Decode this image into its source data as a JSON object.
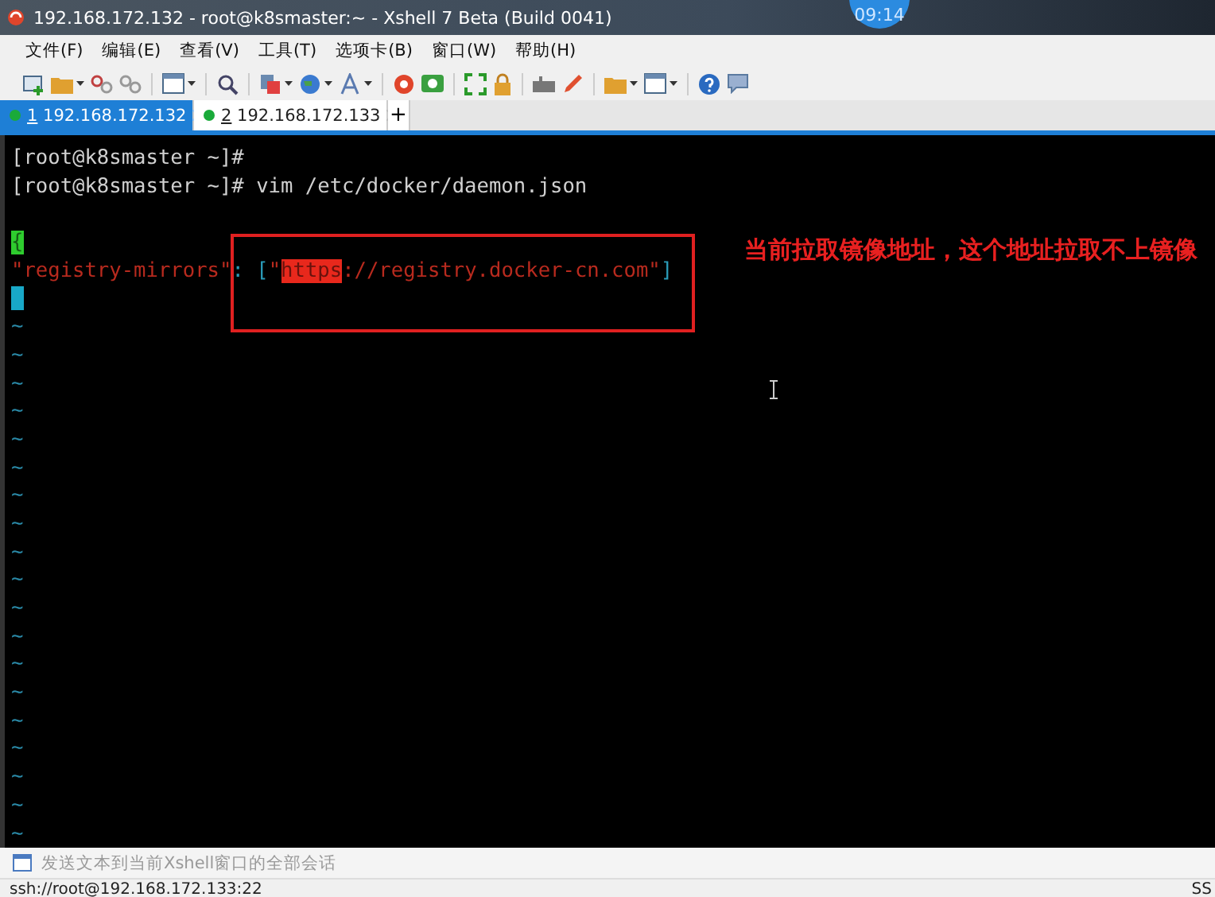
{
  "window": {
    "title": "192.168.172.132 - root@k8smaster:~ - Xshell 7 Beta (Build 0041)"
  },
  "clock": "09:14",
  "menu": [
    "文件(F)",
    "编辑(E)",
    "查看(V)",
    "工具(T)",
    "选项卡(B)",
    "窗口(W)",
    "帮助(H)"
  ],
  "tabs": [
    {
      "index": "1",
      "host": "192.168.172.132",
      "selected": true,
      "connected": true
    },
    {
      "index": "2",
      "host": "192.168.172.133",
      "selected": false,
      "connected": true
    }
  ],
  "new_tab": "+",
  "terminal": {
    "lines": [
      {
        "kind": "text",
        "segments": [
          {
            "text": "[root@k8smaster ~]#",
            "kind": "plain",
            "color": "#d0d0d0"
          }
        ]
      },
      {
        "kind": "text",
        "segments": [
          {
            "text": "[root@k8smaster ~]# vim /etc/docker/daemon.json",
            "kind": "plain",
            "color": "#d0d0d0"
          }
        ]
      },
      {
        "kind": "blank"
      },
      {
        "kind": "text",
        "segments": [
          {
            "text": "{",
            "kind": "highlighted",
            "color": "#2ecc2e"
          }
        ]
      },
      {
        "kind": "text",
        "segments": [
          {
            "text": "\"registry-mirrors\"",
            "kind": "plain",
            "color": "#b82a1e"
          },
          {
            "text": ": [",
            "kind": "plain",
            "color": "#2a9bb8"
          },
          {
            "text": "\"",
            "kind": "plain",
            "color": "#b82a1e"
          },
          {
            "text": "https",
            "kind": "highlighted",
            "color": "#e8281c"
          },
          {
            "text": "://registry.docker-cn.com\"",
            "kind": "plain",
            "color": "#b82a1e"
          },
          {
            "text": "]",
            "kind": "plain",
            "color": "#2a9bb8"
          }
        ]
      },
      {
        "kind": "cursor"
      },
      {
        "kind": "tilde",
        "text": "~"
      },
      {
        "kind": "tilde",
        "text": "~"
      },
      {
        "kind": "tilde",
        "text": "~"
      },
      {
        "kind": "tilde",
        "text": "~"
      },
      {
        "kind": "tilde",
        "text": "~"
      },
      {
        "kind": "tilde",
        "text": "~"
      },
      {
        "kind": "tilde",
        "text": "~"
      },
      {
        "kind": "tilde",
        "text": "~"
      },
      {
        "kind": "tilde",
        "text": "~"
      },
      {
        "kind": "tilde",
        "text": "~"
      },
      {
        "kind": "tilde",
        "text": "~"
      },
      {
        "kind": "tilde",
        "text": "~"
      },
      {
        "kind": "tilde",
        "text": "~"
      },
      {
        "kind": "tilde",
        "text": "~"
      },
      {
        "kind": "tilde",
        "text": "~"
      },
      {
        "kind": "tilde",
        "text": "~"
      },
      {
        "kind": "tilde",
        "text": "~"
      },
      {
        "kind": "tilde",
        "text": "~"
      },
      {
        "kind": "tilde",
        "text": "~"
      }
    ]
  },
  "annotation": {
    "text": "当前拉取镜像地址，这个地址拉取不上镜像"
  },
  "send_bar": {
    "placeholder": "发送文本到当前Xshell窗口的全部会话"
  },
  "status_bar": {
    "connection": "ssh://root@192.168.172.133:22",
    "protocol": "SS"
  }
}
